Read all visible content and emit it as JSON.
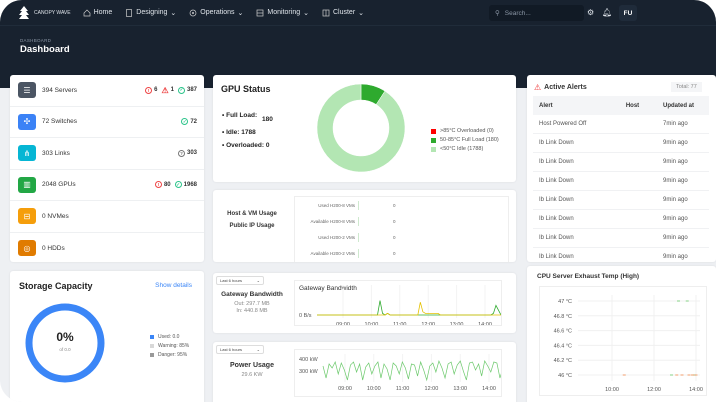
{
  "brand": "CANOPY WAVE",
  "nav": [
    {
      "label": "Home",
      "icon": "home-icon"
    },
    {
      "label": "Designing",
      "icon": "document-icon"
    },
    {
      "label": "Operations",
      "icon": "gear-icon"
    },
    {
      "label": "Monitoring",
      "icon": "monitor-icon"
    },
    {
      "label": "Cluster",
      "icon": "cluster-icon"
    }
  ],
  "search": {
    "placeholder": "Search..."
  },
  "user": {
    "initials": "FU"
  },
  "breadcrumb": "DASHBOARD",
  "page_title": "Dashboard",
  "inventory": [
    {
      "label": "394 Servers",
      "color": "#4b5563",
      "icon": "server-icon",
      "badges": [
        {
          "type": "error",
          "value": "6"
        },
        {
          "type": "warning",
          "value": "1"
        },
        {
          "type": "ok",
          "value": "387"
        }
      ]
    },
    {
      "label": "72 Switches",
      "color": "#3b82f6",
      "icon": "switch-icon",
      "badges": [
        {
          "type": "ok",
          "value": "72"
        }
      ]
    },
    {
      "label": "303 Links",
      "color": "#06b6d4",
      "icon": "link-icon",
      "badges": [
        {
          "type": "unknown",
          "value": "303"
        }
      ]
    },
    {
      "label": "2048 GPUs",
      "color": "#22a745",
      "icon": "gpu-icon",
      "badges": [
        {
          "type": "error",
          "value": "80"
        },
        {
          "type": "ok",
          "value": "1968"
        }
      ]
    },
    {
      "label": "0 NVMes",
      "color": "#f59e0b",
      "icon": "nvme-icon",
      "badges": []
    },
    {
      "label": "0 HDDs",
      "color": "#e07b00",
      "icon": "hdd-icon",
      "badges": []
    }
  ],
  "gpu_status": {
    "title": "GPU Status",
    "full_load_label": "Full Load:",
    "full_load": "180",
    "idle_label": "Idle:",
    "idle": "1788",
    "overloaded_label": "Overloaded:",
    "overloaded": "0",
    "legend": [
      {
        "label": ">85°C Overloaded (0)",
        "color": "#ff0000",
        "value": 0
      },
      {
        "label": "50-85°C Full Load (180)",
        "color": "#2eaa2e",
        "value": 180
      },
      {
        "label": "<50°C Idle (1788)",
        "color": "#b3e6b3",
        "value": 1788
      }
    ]
  },
  "usage": {
    "host_vm": "Host & VM Usage",
    "public_ip": "Public IP Usage",
    "rows": [
      {
        "label": "Used H200-8 VMs",
        "value": "0"
      },
      {
        "label": "Available H200-8 VMs",
        "value": "0"
      },
      {
        "label": "Used H200-2 VMs",
        "value": "0"
      },
      {
        "label": "Available H200-2 VMs",
        "value": "0"
      }
    ]
  },
  "storage": {
    "title": "Storage Capacity",
    "link": "Show details",
    "percent": "0%",
    "of": "of 0.0",
    "used_fraction": 0,
    "ring_color": "#3b86f7",
    "legend": [
      {
        "label": "Used: 0.0",
        "color": "#3b86f7"
      },
      {
        "label": "Warning: 85%",
        "color": "#d8d8d8"
      },
      {
        "label": "Danger: 95%",
        "color": "#999999"
      }
    ]
  },
  "gateway": {
    "range": "Last 6 hours",
    "title": "Gateway Bandwidth",
    "out": "Out: 297.7 MB",
    "in": "In: 440.8 MB"
  },
  "power": {
    "range": "Last 6 hours",
    "title": "Power Usage",
    "value": "29.6 KW"
  },
  "alerts": {
    "title": "Active Alerts",
    "total": "Total: 77",
    "columns": [
      "Alert",
      "Host",
      "Updated at"
    ],
    "rows": [
      [
        "Host Powered Off",
        "",
        "7min ago"
      ],
      [
        "Ib Link Down",
        "",
        "9min ago"
      ],
      [
        "Ib Link Down",
        "",
        "9min ago"
      ],
      [
        "Ib Link Down",
        "",
        "9min ago"
      ],
      [
        "Ib Link Down",
        "",
        "9min ago"
      ],
      [
        "Ib Link Down",
        "",
        "9min ago"
      ],
      [
        "Ib Link Down",
        "",
        "9min ago"
      ],
      [
        "Ib Link Down",
        "",
        "9min ago"
      ]
    ]
  },
  "chart_data": [
    {
      "type": "line",
      "title": "Gateway Bandwidth",
      "x_ticks": [
        "09:00",
        "10:00",
        "11:00",
        "12:00",
        "13:00",
        "14:00"
      ],
      "y_ticks": [
        "0 B/s"
      ],
      "series": [
        {
          "color": "#2eaa2e",
          "values": [
            0,
            0,
            0,
            0,
            0,
            0,
            0,
            0,
            0,
            0,
            0,
            0,
            0,
            0,
            0,
            0,
            0,
            0,
            0,
            0,
            0,
            0,
            0,
            0,
            0,
            9,
            1,
            0,
            1,
            0,
            0,
            0,
            0,
            0,
            0,
            0,
            0,
            0,
            0,
            0,
            0,
            0,
            0,
            0,
            0,
            0,
            0,
            0,
            0,
            0,
            0,
            0,
            0,
            0,
            0,
            0,
            0,
            0,
            0,
            0,
            0,
            0,
            0,
            0,
            0,
            0,
            0,
            0,
            0,
            0,
            1,
            6,
            3,
            0
          ]
        },
        {
          "color": "#e5c100",
          "values": [
            0,
            0,
            0,
            0,
            0,
            0,
            0,
            0,
            0,
            0,
            0,
            0,
            0,
            0,
            0,
            0,
            0,
            0,
            0,
            0,
            0,
            0,
            0,
            0,
            0,
            0,
            0,
            0,
            1,
            0,
            0,
            0,
            0,
            0,
            0,
            0,
            0,
            0,
            0,
            0,
            0,
            8,
            2,
            1,
            1,
            1,
            1,
            1,
            1,
            0,
            0,
            0,
            0,
            0,
            0,
            0,
            0,
            0,
            0,
            0,
            0,
            0,
            0,
            0,
            0,
            0,
            0,
            0,
            0,
            0,
            0,
            0,
            0,
            0
          ]
        }
      ]
    },
    {
      "type": "line",
      "title": "Power Usage",
      "x_ticks": [
        "09:00",
        "10:00",
        "11:00",
        "12:00",
        "13:00",
        "14:00"
      ],
      "y_ticks": [
        "400 kW",
        "300 kW"
      ],
      "color": "#6cc96c",
      "values": [
        370,
        310,
        380,
        360,
        390,
        330,
        385,
        350,
        300,
        375,
        390,
        340,
        380,
        300,
        365,
        385,
        330,
        370,
        390,
        310,
        380,
        355,
        300,
        385,
        370,
        330,
        390,
        360,
        305,
        380,
        375,
        320,
        390,
        350,
        300,
        370,
        385,
        340,
        395,
        360,
        310,
        380,
        390,
        330,
        375,
        395,
        345,
        300,
        385,
        390,
        350,
        380,
        320,
        395,
        370,
        340,
        390,
        385,
        310,
        360
      ]
    },
    {
      "type": "line",
      "title": "CPU Server Exhaust Temp (High)",
      "x_ticks": [
        "10:00",
        "12:00",
        "14:00"
      ],
      "y_ticks": [
        "47 °C",
        "46.8 °C",
        "46.6 °C",
        "46.4 °C",
        "46.2 °C",
        "46 °C"
      ],
      "ylim": [
        46,
        47
      ],
      "series": [
        {
          "color": "#6cc96c",
          "points": [
            [
              "13:10",
              47
            ],
            [
              "13:35",
              47
            ],
            [
              "12:50",
              46
            ],
            [
              "13:55",
              46
            ]
          ]
        },
        {
          "color": "#f08a4b",
          "points": [
            [
              "10:35",
              46
            ],
            [
              "13:05",
              46
            ],
            [
              "13:20",
              46
            ],
            [
              "13:40",
              46
            ],
            [
              "13:50",
              46
            ],
            [
              "14:00",
              46
            ]
          ]
        }
      ]
    }
  ]
}
